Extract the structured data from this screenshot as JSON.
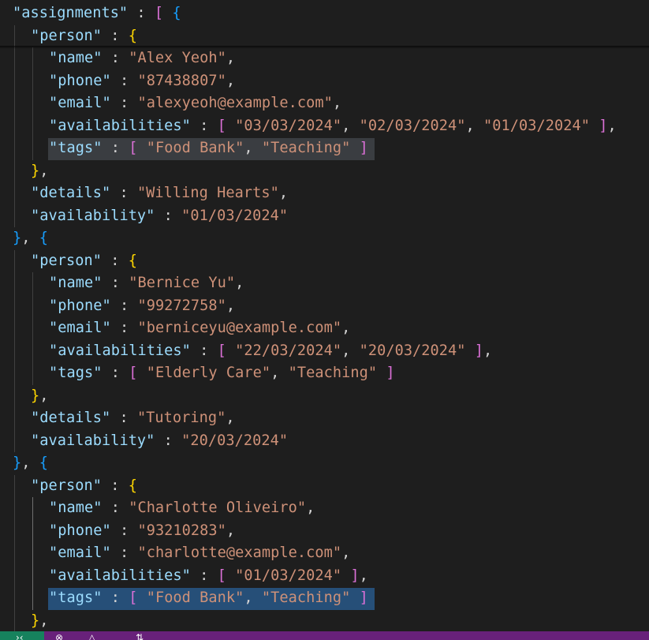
{
  "editor": {
    "lines": [
      {
        "indent": 0,
        "tokens": [
          [
            "k",
            "\"assignments\""
          ],
          [
            "p",
            " : "
          ],
          [
            "b2",
            "["
          ],
          [
            "p",
            " "
          ],
          [
            "b3",
            "{"
          ]
        ]
      },
      {
        "indent": 1,
        "tokens": [
          [
            "k",
            "\"person\""
          ],
          [
            "p",
            " : "
          ],
          [
            "b1",
            "{"
          ]
        ]
      },
      {
        "indent": 2,
        "tokens": [
          [
            "k",
            "\"name\""
          ],
          [
            "p",
            " : "
          ],
          [
            "s",
            "\"Alex Yeoh\""
          ],
          [
            "p",
            ","
          ]
        ]
      },
      {
        "indent": 2,
        "tokens": [
          [
            "k",
            "\"phone\""
          ],
          [
            "p",
            " : "
          ],
          [
            "s",
            "\"87438807\""
          ],
          [
            "p",
            ","
          ]
        ]
      },
      {
        "indent": 2,
        "tokens": [
          [
            "k",
            "\"email\""
          ],
          [
            "p",
            " : "
          ],
          [
            "s",
            "\"alexyeoh@example.com\""
          ],
          [
            "p",
            ","
          ]
        ]
      },
      {
        "indent": 2,
        "tokens": [
          [
            "k",
            "\"availabilities\""
          ],
          [
            "p",
            " : "
          ],
          [
            "b2",
            "["
          ],
          [
            "p",
            " "
          ],
          [
            "s",
            "\"03/03/2024\""
          ],
          [
            "p",
            ", "
          ],
          [
            "s",
            "\"02/03/2024\""
          ],
          [
            "p",
            ", "
          ],
          [
            "s",
            "\"01/03/2024\""
          ],
          [
            "p",
            " "
          ],
          [
            "b2",
            "]"
          ],
          [
            "p",
            ","
          ]
        ]
      },
      {
        "indent": 2,
        "tokens": [
          [
            "k",
            "\"tags\""
          ],
          [
            "p",
            " : "
          ],
          [
            "b2",
            "["
          ],
          [
            "p",
            " "
          ],
          [
            "s",
            "\"Food Bank\""
          ],
          [
            "p",
            ", "
          ],
          [
            "s",
            "\"Teaching\""
          ],
          [
            "p",
            " "
          ],
          [
            "b2",
            "]"
          ]
        ],
        "highlight": "gray"
      },
      {
        "indent": 1,
        "tokens": [
          [
            "b1",
            "}"
          ],
          [
            "p",
            ","
          ]
        ]
      },
      {
        "indent": 1,
        "tokens": [
          [
            "k",
            "\"details\""
          ],
          [
            "p",
            " : "
          ],
          [
            "s",
            "\"Willing Hearts\""
          ],
          [
            "p",
            ","
          ]
        ]
      },
      {
        "indent": 1,
        "tokens": [
          [
            "k",
            "\"availability\""
          ],
          [
            "p",
            " : "
          ],
          [
            "s",
            "\"01/03/2024\""
          ]
        ]
      },
      {
        "indent": 0,
        "tokens": [
          [
            "b3",
            "}"
          ],
          [
            "p",
            ", "
          ],
          [
            "b3",
            "{"
          ]
        ]
      },
      {
        "indent": 1,
        "tokens": [
          [
            "k",
            "\"person\""
          ],
          [
            "p",
            " : "
          ],
          [
            "b1",
            "{"
          ]
        ]
      },
      {
        "indent": 2,
        "tokens": [
          [
            "k",
            "\"name\""
          ],
          [
            "p",
            " : "
          ],
          [
            "s",
            "\"Bernice Yu\""
          ],
          [
            "p",
            ","
          ]
        ]
      },
      {
        "indent": 2,
        "tokens": [
          [
            "k",
            "\"phone\""
          ],
          [
            "p",
            " : "
          ],
          [
            "s",
            "\"99272758\""
          ],
          [
            "p",
            ","
          ]
        ]
      },
      {
        "indent": 2,
        "tokens": [
          [
            "k",
            "\"email\""
          ],
          [
            "p",
            " : "
          ],
          [
            "s",
            "\"berniceyu@example.com\""
          ],
          [
            "p",
            ","
          ]
        ]
      },
      {
        "indent": 2,
        "tokens": [
          [
            "k",
            "\"availabilities\""
          ],
          [
            "p",
            " : "
          ],
          [
            "b2",
            "["
          ],
          [
            "p",
            " "
          ],
          [
            "s",
            "\"22/03/2024\""
          ],
          [
            "p",
            ", "
          ],
          [
            "s",
            "\"20/03/2024\""
          ],
          [
            "p",
            " "
          ],
          [
            "b2",
            "]"
          ],
          [
            "p",
            ","
          ]
        ]
      },
      {
        "indent": 2,
        "tokens": [
          [
            "k",
            "\"tags\""
          ],
          [
            "p",
            " : "
          ],
          [
            "b2",
            "["
          ],
          [
            "p",
            " "
          ],
          [
            "s",
            "\"Elderly Care\""
          ],
          [
            "p",
            ", "
          ],
          [
            "s",
            "\"Teaching\""
          ],
          [
            "p",
            " "
          ],
          [
            "b2",
            "]"
          ]
        ]
      },
      {
        "indent": 1,
        "tokens": [
          [
            "b1",
            "}"
          ],
          [
            "p",
            ","
          ]
        ]
      },
      {
        "indent": 1,
        "tokens": [
          [
            "k",
            "\"details\""
          ],
          [
            "p",
            " : "
          ],
          [
            "s",
            "\"Tutoring\""
          ],
          [
            "p",
            ","
          ]
        ]
      },
      {
        "indent": 1,
        "tokens": [
          [
            "k",
            "\"availability\""
          ],
          [
            "p",
            " : "
          ],
          [
            "s",
            "\"20/03/2024\""
          ]
        ]
      },
      {
        "indent": 0,
        "tokens": [
          [
            "b3",
            "}"
          ],
          [
            "p",
            ", "
          ],
          [
            "b3",
            "{"
          ]
        ]
      },
      {
        "indent": 1,
        "tokens": [
          [
            "k",
            "\"person\""
          ],
          [
            "p",
            " : "
          ],
          [
            "b1",
            "{"
          ]
        ]
      },
      {
        "indent": 2,
        "tokens": [
          [
            "k",
            "\"name\""
          ],
          [
            "p",
            " : "
          ],
          [
            "s",
            "\"Charlotte Oliveiro\""
          ],
          [
            "p",
            ","
          ]
        ]
      },
      {
        "indent": 2,
        "tokens": [
          [
            "k",
            "\"phone\""
          ],
          [
            "p",
            " : "
          ],
          [
            "s",
            "\"93210283\""
          ],
          [
            "p",
            ","
          ]
        ]
      },
      {
        "indent": 2,
        "tokens": [
          [
            "k",
            "\"email\""
          ],
          [
            "p",
            " : "
          ],
          [
            "s",
            "\"charlotte@example.com\""
          ],
          [
            "p",
            ","
          ]
        ]
      },
      {
        "indent": 2,
        "tokens": [
          [
            "k",
            "\"availabilities\""
          ],
          [
            "p",
            " : "
          ],
          [
            "b2",
            "["
          ],
          [
            "p",
            " "
          ],
          [
            "s",
            "\"01/03/2024\""
          ],
          [
            "p",
            " "
          ],
          [
            "b2",
            "]"
          ],
          [
            "p",
            ","
          ]
        ]
      },
      {
        "indent": 2,
        "tokens": [
          [
            "k",
            "\"tags\""
          ],
          [
            "p",
            " : "
          ],
          [
            "b2",
            "["
          ],
          [
            "p",
            " "
          ],
          [
            "s",
            "\"Food Bank\""
          ],
          [
            "p",
            ", "
          ],
          [
            "s",
            "\"Teaching\""
          ],
          [
            "p",
            " "
          ],
          [
            "b2",
            "]"
          ]
        ],
        "highlight": "blue"
      },
      {
        "indent": 1,
        "tokens": [
          [
            "b1",
            "}"
          ],
          [
            "p",
            ","
          ]
        ]
      }
    ]
  },
  "status_bar": {
    "background": "#68217a",
    "icons": [
      "remote-icon",
      "error-icon",
      "warning-icon",
      "sync-icon"
    ]
  },
  "colors": {
    "key": "#9cdcfe",
    "string": "#ce9178",
    "punctuation": "#d4d4d4",
    "bracket_level_1": "#ffd700",
    "bracket_level_2": "#da70d6",
    "bracket_level_3": "#179fff",
    "selection_gray": "#3a3d41",
    "selection_blue": "#264f78"
  }
}
